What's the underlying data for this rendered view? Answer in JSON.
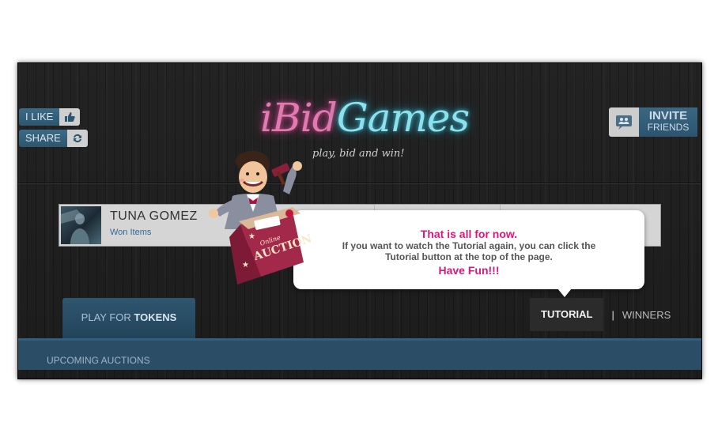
{
  "social": {
    "like_label": "I LIKE",
    "share_label": "SHARE"
  },
  "invite": {
    "line1": "INVITE",
    "line2": "FRIENDS"
  },
  "logo": {
    "part1": "iBid",
    "part2": "Games",
    "tagline": "play, bid and win!"
  },
  "player": {
    "name": "TUNA GOMEZ",
    "won_items_label": "Won Items"
  },
  "tooltip": {
    "title": "That is all for now.",
    "body": "If you want to watch the Tutorial again, you can click the Tutorial button at the top of the page.",
    "closing": "Have Fun!!!"
  },
  "mascot": {
    "podium_text": "AUCTION",
    "podium_small": "Online"
  },
  "tabs": {
    "play_prefix": "PLAY FOR ",
    "play_strong": "TOKENS",
    "tutorial": "TUTORIAL",
    "separator": "|",
    "winners": "WINNERS"
  },
  "section": {
    "upcoming_label": "UPCOMING AUCTIONS"
  },
  "colors": {
    "pink": "#e0157a",
    "navy_blue": "#2b4d66",
    "cyan_glow": "#8fe0ec"
  },
  "icons": {
    "like": "thumbs-up-icon",
    "share": "refresh-icon",
    "invite": "friends-icon"
  }
}
